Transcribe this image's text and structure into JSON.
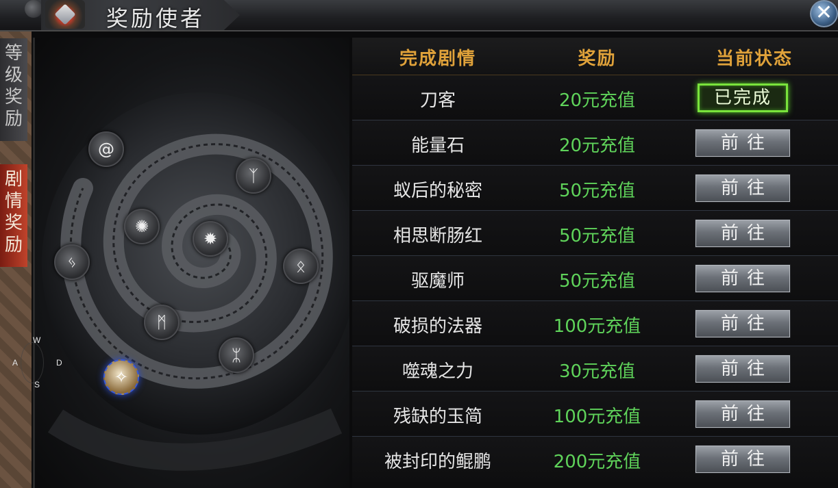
{
  "window": {
    "title": "奖励使者",
    "close_label": "✕"
  },
  "sidebar": {
    "tabs": [
      {
        "label": [
          "等",
          "级",
          "奖",
          "励"
        ],
        "active": false
      },
      {
        "label": [
          "剧",
          "情",
          "奖",
          "励"
        ],
        "active": true
      }
    ]
  },
  "controls": {
    "w": "W",
    "a": "A",
    "s": "S",
    "d": "D"
  },
  "map": {
    "nodes": [
      {
        "glyph": "@",
        "icon": "swirl-rune-icon",
        "active": false
      },
      {
        "glyph": "ᛉ",
        "icon": "claw-rune-icon",
        "active": false
      },
      {
        "glyph": "✺",
        "icon": "cloud-rune-icon",
        "active": false
      },
      {
        "glyph": "✹",
        "icon": "sun-rune-icon",
        "active": false
      },
      {
        "glyph": "ᛃ",
        "icon": "wing-rune-icon",
        "active": false
      },
      {
        "glyph": "ᛟ",
        "icon": "flame-rune-icon",
        "active": false
      },
      {
        "glyph": "ᛗ",
        "icon": "demon-rune-icon",
        "active": false
      },
      {
        "glyph": "ᛯ",
        "icon": "feather-rune-icon",
        "active": false
      },
      {
        "glyph": "✧",
        "icon": "spark-rune-icon",
        "active": true
      }
    ]
  },
  "table": {
    "headers": [
      "完成剧情",
      "奖励",
      "当前状态"
    ],
    "rows": [
      {
        "name": "刀客",
        "reward": "20元充值",
        "status": "已完成",
        "done": true
      },
      {
        "name": "能量石",
        "reward": "20元充值",
        "status": "前往",
        "done": false
      },
      {
        "name": "蚁后的秘密",
        "reward": "50元充值",
        "status": "前往",
        "done": false
      },
      {
        "name": "相思断肠红",
        "reward": "50元充值",
        "status": "前往",
        "done": false
      },
      {
        "name": "驱魔师",
        "reward": "50元充值",
        "status": "前往",
        "done": false
      },
      {
        "name": "破损的法器",
        "reward": "100元充值",
        "status": "前往",
        "done": false
      },
      {
        "name": "噬魂之力",
        "reward": "30元充值",
        "status": "前往",
        "done": false
      },
      {
        "name": "残缺的玉简",
        "reward": "100元充值",
        "status": "前往",
        "done": false
      },
      {
        "name": "被封印的鲲鹏",
        "reward": "200元充值",
        "status": "前往",
        "done": false
      }
    ]
  },
  "colors": {
    "header_gold": "#e0a23a",
    "reward_green": "#5fd35a",
    "done_border": "#7ae33c",
    "tab_active": "#c0432b"
  }
}
